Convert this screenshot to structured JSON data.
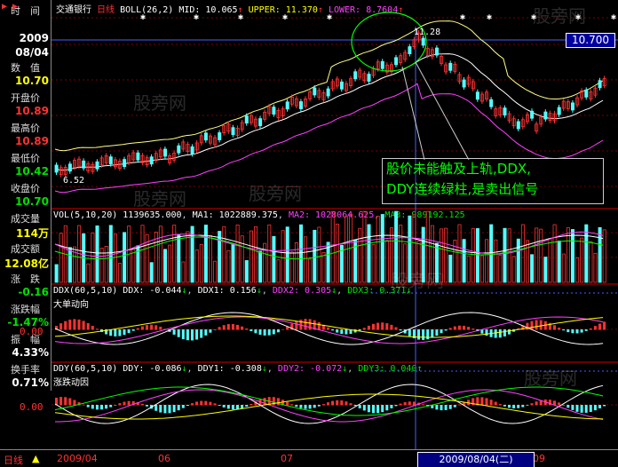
{
  "stock": {
    "name": "交通银行",
    "period": "日线"
  },
  "boll_header": {
    "label": "BOLL(26,2)",
    "mid": "MID: 10.065",
    "upper": "UPPER: 11.370",
    "lower": "LOWER: 8.7604"
  },
  "vol_header": {
    "label": "VOL(5,10,20)",
    "vol": "1139635.000",
    "ma1": "MA1: 1022889.375",
    "ma2": "MA2: 1028064.625",
    "ma3": "MA3: 989192.125"
  },
  "ddx_header": {
    "label": "DDX(60,5,10)",
    "ddx": "DDX: -0.044",
    "ddx1": "DDX1: 0.156",
    "ddx2": "DDX2: 0.305",
    "ddx3": "DDX3: 0.371",
    "subtitle": "大单动向"
  },
  "ddy_header": {
    "label": "DDY(60,5,10)",
    "ddy": "DDY: -0.086",
    "ddy1": "DDY1: -0.308",
    "ddy2": "DDY2: -0.072",
    "ddy3": "DDY3: 0.040",
    "subtitle": "涨跌动因"
  },
  "panel": {
    "time_label": "时　间",
    "year": "2009",
    "date": "08/04",
    "value_label": "数　值",
    "value": "10.70",
    "open_label": "开盘价",
    "open": "10.89",
    "high_label": "最高价",
    "high": "10.89",
    "low_label": "最低价",
    "low": "10.42",
    "close_label": "收盘价",
    "close": "10.70",
    "vol_label": "成交量",
    "vol": "114万",
    "amount_label": "成交额",
    "amount": "12.08亿",
    "change_label": "涨　跌",
    "change": "-0.16",
    "pct_label": "涨跌幅",
    "pct": "-1.47%",
    "amp_label": "振　幅",
    "amp": "4.33%",
    "turnover_label": "换手率",
    "turnover": "0.71%"
  },
  "price_tag": "10.700",
  "peak_label": "11.28",
  "low_label": "6.52",
  "ddx_axis": "0.00",
  "ddy_axis": "0.00",
  "annotation": {
    "line1": "股价未能触及上轨,DDX,",
    "line2": "DDY连续绿柱,是卖出信号"
  },
  "bottom": {
    "period_label": "日线",
    "ticks": [
      "2009/04",
      "06",
      "07",
      "09"
    ],
    "cursor_date": "2009/08/04(二)"
  },
  "watermark": "股旁网",
  "colors": {
    "up": "#ff3232",
    "down": "#54ffff",
    "mid": "#ffffff",
    "upper": "#ffff80",
    "lower": "#ff40ff"
  }
}
